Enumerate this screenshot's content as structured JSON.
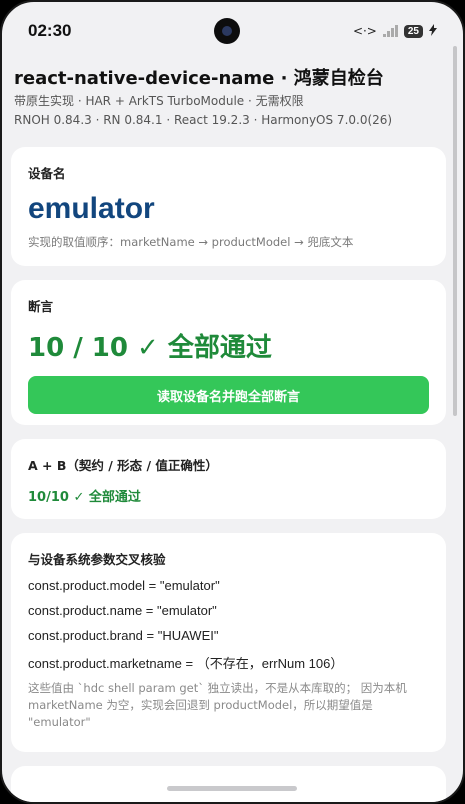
{
  "status_bar": {
    "time": "02:30",
    "network": "<·>",
    "battery": "25",
    "icons": [
      "network-icon",
      "signal-icon",
      "battery-icon",
      "charging-icon"
    ]
  },
  "header": {
    "title": "react-native-device-name · 鸿蒙自检台",
    "line1": "带原生实现 · HAR + ArkTS TurboModule · 无需权限",
    "line2": "RNOH 0.84.3 · RN 0.84.1 · React 19.2.3 · HarmonyOS 7.0.0(26)"
  },
  "device_card": {
    "label": "设备名",
    "value": "emulator",
    "hint": "实现的取值顺序：marketName → productModel → 兜底文本"
  },
  "assert_card": {
    "label": "断言",
    "result": "10 / 10 ✓ 全部通过",
    "button_label": "读取设备名并跑全部断言"
  },
  "ab_card": {
    "label": "A + B（契约 / 形态 / 值正确性）",
    "result": "10/10 ✓ 全部通过"
  },
  "cross_card": {
    "label": "与设备系统参数交叉核验",
    "lines": [
      "const.product.model = \"emulator\"",
      "const.product.name = \"emulator\"",
      "const.product.brand = \"HUAWEI\"",
      "const.product.marketname = （不存在，errNum 106）"
    ],
    "note": "这些值由 `hdc shell param get` 独立读出，不是从本库取的； 因为本机 marketName 为空，实现会回退到 productModel，所以期望值是 \"emulator\""
  },
  "colors": {
    "accent_green": "#34c759",
    "pass_green": "#1f8a3a",
    "name_blue": "#12467e"
  }
}
